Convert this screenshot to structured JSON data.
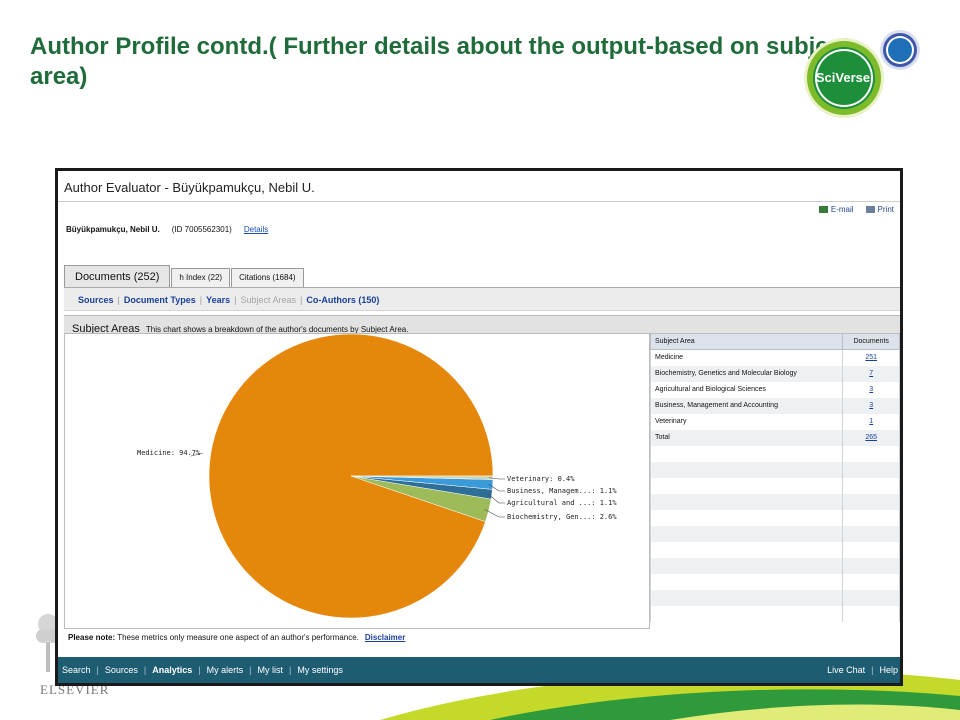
{
  "slide": {
    "title": "Author Profile contd.( Further details about the output-based on subject area)",
    "logo_text": "SciVerse",
    "footer_brand": "ELSEVIER"
  },
  "window": {
    "title": "Author Evaluator - Büyükpamukçu, Nebil U.",
    "toolbar": {
      "email": "E-mail",
      "print": "Print"
    },
    "author": {
      "name": "Büyükpamukçu, Nebil U.",
      "id": "(ID 7005562301)",
      "details": "Details"
    },
    "tabs": [
      {
        "label": "Documents (252)",
        "active": true
      },
      {
        "label": "h Index (22)",
        "active": false
      },
      {
        "label": "Citations (1684)",
        "active": false
      }
    ],
    "subnav": [
      "Sources",
      "Document Types",
      "Years",
      "Subject Areas",
      "Co-Authors (150)"
    ],
    "section": {
      "title": "Subject Areas",
      "description": "This chart shows a breakdown of the author's documents by Subject Area."
    },
    "table": {
      "headers": [
        "Subject Area",
        "Documents"
      ],
      "rows": [
        {
          "area": "Medicine",
          "docs": "251"
        },
        {
          "area": "Biochemistry, Genetics and Molecular Biology",
          "docs": "7"
        },
        {
          "area": "Agricultural and Biological Sciences",
          "docs": "3"
        },
        {
          "area": "Business, Management and Accounting",
          "docs": "3"
        },
        {
          "area": "Veterinary",
          "docs": "1"
        },
        {
          "area": "Total",
          "docs": "265"
        }
      ]
    },
    "note": {
      "label": "Please note:",
      "text": "These metrics only measure one aspect of an author's performance.",
      "link": "Disclaimer"
    },
    "bottom_nav": {
      "left": [
        "Search",
        "Sources",
        "Analytics",
        "My alerts",
        "My list",
        "My settings"
      ],
      "active": "Analytics",
      "right": [
        "Live Chat",
        "Help"
      ]
    }
  },
  "chart_data": {
    "type": "pie",
    "title": "",
    "slices": [
      {
        "label": "Medicine: 94.7%",
        "value": 94.7,
        "color": "#e5870a"
      },
      {
        "label": "Biochemistry, Gen...: 2.6%",
        "value": 2.6,
        "color": "#9ebb59"
      },
      {
        "label": "Agricultural and ...: 1.1%",
        "value": 1.1,
        "color": "#2e6f98"
      },
      {
        "label": "Business, Managem...: 1.1%",
        "value": 1.1,
        "color": "#3b9ad9"
      },
      {
        "label": "Veterinary: 0.4%",
        "value": 0.4,
        "color": "#cdd5b4"
      }
    ]
  },
  "colors": {
    "title_green": "#1f6b3a",
    "nav_bar": "#1e5c72",
    "link_blue": "#1a3f9a"
  }
}
